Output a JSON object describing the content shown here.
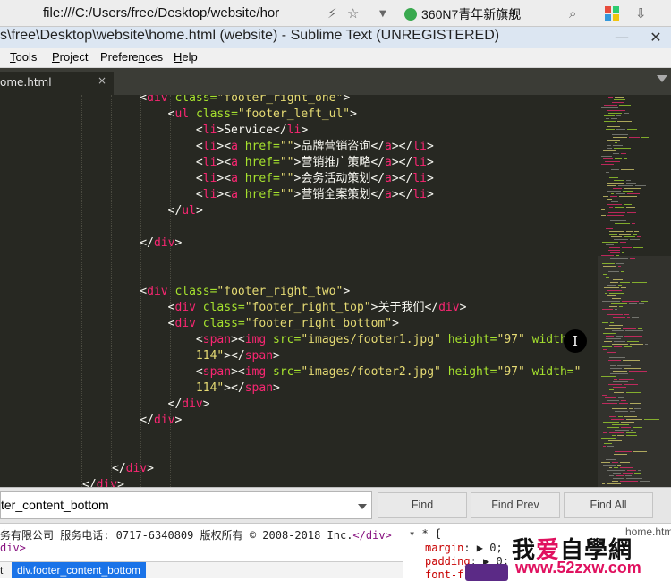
{
  "browser": {
    "url": "file:///C:/Users/free/Desktop/website/hor",
    "tab_title": "360N7青年新旗舰"
  },
  "window": {
    "title": "s\\free\\Desktop\\website\\home.html (website) - Sublime Text (UNREGISTERED)",
    "minimize": "—",
    "close": "✕"
  },
  "menu": [
    {
      "pre": "",
      "ul": "T",
      "post": "ools"
    },
    {
      "pre": "",
      "ul": "P",
      "post": "roject"
    },
    {
      "pre": "Prefere",
      "ul": "n",
      "post": "ces"
    },
    {
      "pre": "",
      "ul": "H",
      "post": "elp"
    }
  ],
  "tab": {
    "label": "ome.html",
    "close": "×"
  },
  "editor": {
    "lines": [
      [
        [
          "t",
          "    <"
        ],
        [
          "tag",
          "div "
        ],
        [
          "attr",
          "class="
        ],
        [
          "val",
          "\"footer_right_one\""
        ],
        [
          "t",
          ">"
        ]
      ],
      [
        [
          "t",
          "        <"
        ],
        [
          "tag",
          "ul "
        ],
        [
          "attr",
          "class="
        ],
        [
          "val",
          "\"footer_left_ul\""
        ],
        [
          "t",
          ">"
        ]
      ],
      [
        [
          "t",
          "            <"
        ],
        [
          "tag",
          "li"
        ],
        [
          "t",
          ">Service</"
        ],
        [
          "tag",
          "li"
        ],
        [
          "t",
          ">"
        ]
      ],
      [
        [
          "t",
          "            <"
        ],
        [
          "tag",
          "li"
        ],
        [
          "t",
          "><"
        ],
        [
          "tag",
          "a "
        ],
        [
          "attr",
          "href="
        ],
        [
          "val",
          "\"\""
        ],
        [
          "t",
          ">品牌营销咨询</"
        ],
        [
          "tag",
          "a"
        ],
        [
          "t",
          "></"
        ],
        [
          "tag",
          "li"
        ],
        [
          "t",
          ">"
        ]
      ],
      [
        [
          "t",
          "            <"
        ],
        [
          "tag",
          "li"
        ],
        [
          "t",
          "><"
        ],
        [
          "tag",
          "a "
        ],
        [
          "attr",
          "href="
        ],
        [
          "val",
          "\"\""
        ],
        [
          "t",
          ">营销推广策略</"
        ],
        [
          "tag",
          "a"
        ],
        [
          "t",
          "></"
        ],
        [
          "tag",
          "li"
        ],
        [
          "t",
          ">"
        ]
      ],
      [
        [
          "t",
          "            <"
        ],
        [
          "tag",
          "li"
        ],
        [
          "t",
          "><"
        ],
        [
          "tag",
          "a "
        ],
        [
          "attr",
          "href="
        ],
        [
          "val",
          "\"\""
        ],
        [
          "t",
          ">会务活动策划</"
        ],
        [
          "tag",
          "a"
        ],
        [
          "t",
          "></"
        ],
        [
          "tag",
          "li"
        ],
        [
          "t",
          ">"
        ]
      ],
      [
        [
          "t",
          "            <"
        ],
        [
          "tag",
          "li"
        ],
        [
          "t",
          "><"
        ],
        [
          "tag",
          "a "
        ],
        [
          "attr",
          "href="
        ],
        [
          "val",
          "\"\""
        ],
        [
          "t",
          ">营销全案策划</"
        ],
        [
          "tag",
          "a"
        ],
        [
          "t",
          "></"
        ],
        [
          "tag",
          "li"
        ],
        [
          "t",
          ">"
        ]
      ],
      [
        [
          "t",
          "        </"
        ],
        [
          "tag",
          "ul"
        ],
        [
          "t",
          ">"
        ]
      ],
      [
        [
          "t",
          ""
        ]
      ],
      [
        [
          "t",
          "    </"
        ],
        [
          "tag",
          "div"
        ],
        [
          "t",
          ">"
        ]
      ],
      [
        [
          "t",
          ""
        ]
      ],
      [
        [
          "t",
          ""
        ]
      ],
      [
        [
          "t",
          "    <"
        ],
        [
          "tag",
          "div "
        ],
        [
          "attr",
          "class="
        ],
        [
          "val",
          "\"footer_right_two\""
        ],
        [
          "t",
          ">"
        ]
      ],
      [
        [
          "t",
          "        <"
        ],
        [
          "tag",
          "div "
        ],
        [
          "attr",
          "class="
        ],
        [
          "val",
          "\"footer_right_top\""
        ],
        [
          "t",
          ">关于我们</"
        ],
        [
          "tag",
          "div"
        ],
        [
          "t",
          ">"
        ]
      ],
      [
        [
          "t",
          "        <"
        ],
        [
          "tag",
          "div "
        ],
        [
          "attr",
          "class="
        ],
        [
          "val",
          "\"footer_right_bottom\""
        ],
        [
          "t",
          ">"
        ]
      ],
      [
        [
          "t",
          "            <"
        ],
        [
          "tag",
          "span"
        ],
        [
          "t",
          "><"
        ],
        [
          "tag",
          "img "
        ],
        [
          "attr",
          "src="
        ],
        [
          "val",
          "\"images/footer1.jpg\" "
        ],
        [
          "attr",
          "height="
        ],
        [
          "val",
          "\"97\" "
        ],
        [
          "attr",
          "width="
        ],
        [
          "val",
          "\""
        ]
      ],
      [
        [
          "t",
          "            "
        ],
        [
          "val",
          "114\""
        ],
        [
          "t",
          "></"
        ],
        [
          "tag",
          "span"
        ],
        [
          "t",
          ">"
        ]
      ],
      [
        [
          "t",
          "            <"
        ],
        [
          "tag",
          "span"
        ],
        [
          "t",
          "><"
        ],
        [
          "tag",
          "img "
        ],
        [
          "attr",
          "src="
        ],
        [
          "val",
          "\"images/footer2.jpg\" "
        ],
        [
          "attr",
          "height="
        ],
        [
          "val",
          "\"97\" "
        ],
        [
          "attr",
          "width="
        ],
        [
          "val",
          "\""
        ]
      ],
      [
        [
          "t",
          "            "
        ],
        [
          "val",
          "114\""
        ],
        [
          "t",
          "></"
        ],
        [
          "tag",
          "span"
        ],
        [
          "t",
          ">"
        ]
      ],
      [
        [
          "t",
          "        </"
        ],
        [
          "tag",
          "div"
        ],
        [
          "t",
          ">"
        ]
      ],
      [
        [
          "t",
          "    </"
        ],
        [
          "tag",
          "div"
        ],
        [
          "t",
          ">"
        ]
      ],
      [
        [
          "t",
          ""
        ]
      ],
      [
        [
          "t",
          ""
        ]
      ],
      [
        [
          "t",
          "</"
        ],
        [
          "tag",
          "div"
        ],
        [
          "t",
          ">"
        ]
      ],
      [
        [
          "t",
          "</"
        ],
        [
          "tag",
          "div"
        ],
        [
          "t",
          ">"
        ]
      ]
    ]
  },
  "find": {
    "query": "ter_content_bottom",
    "buttons": [
      "Find",
      "Find Prev",
      "Find All"
    ]
  },
  "devtools": {
    "line1_text": "务有限公司 服务电话: 0717-6340809 版权所有 © 2008-2018 Inc.",
    "line1_tag": "</div>",
    "line2": "div>",
    "breadcrumb_a": "t",
    "breadcrumb_b": "div.footer_content_bottom",
    "styles_brace": "* {",
    "styles_props": [
      {
        "name": "margin",
        "value": "0;"
      },
      {
        "name": "padding",
        "value": "0;"
      },
      {
        "name": "font-f",
        "value": ""
      }
    ],
    "styles_source": "home.html:"
  },
  "watermark": {
    "cn_a": "我",
    "cn_b": "爱",
    "cn_c": "自學網",
    "url": "www.52zxw.com"
  }
}
